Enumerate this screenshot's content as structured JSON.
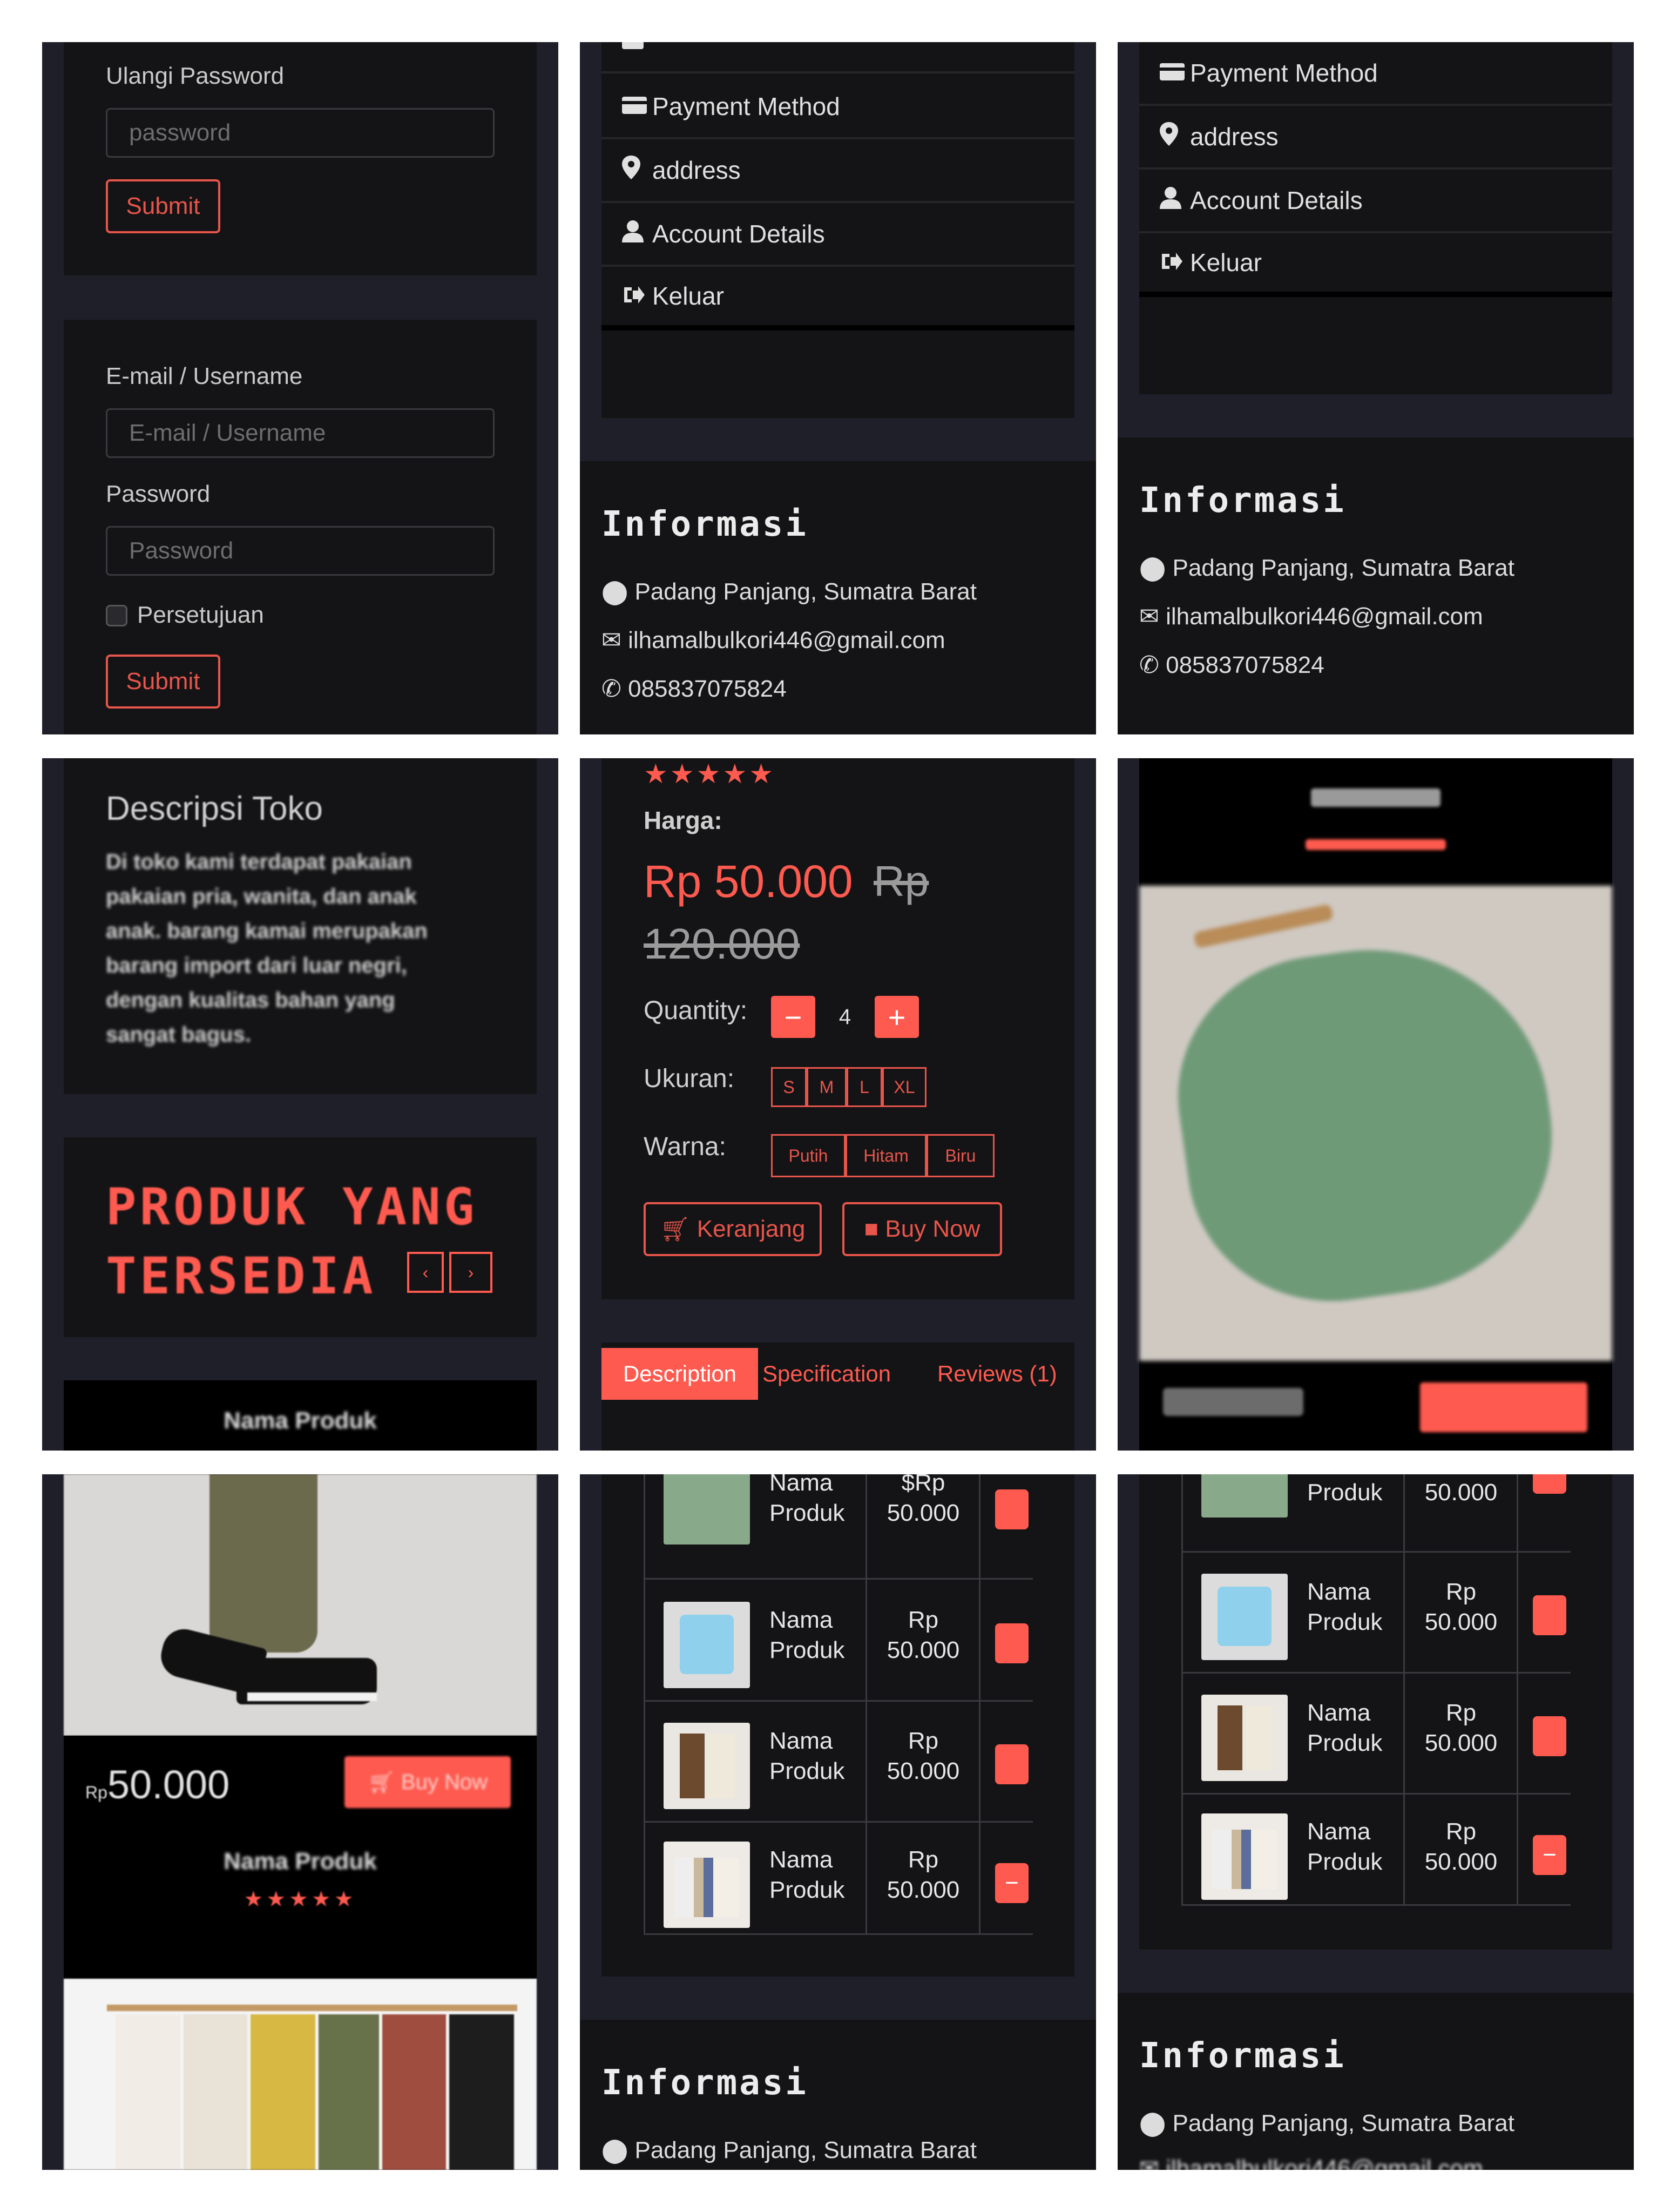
{
  "colors": {
    "accent": "#ff5a4f",
    "panel_bg": "#1f1f29",
    "card_bg": "#141416"
  },
  "p1": {
    "repeat_password_label": "Ulangi Password",
    "repeat_password_placeholder": "password",
    "submit1": "Submit",
    "email_label": "E-mail / Username",
    "email_placeholder": "E-mail / Username",
    "password_label": "Password",
    "password_placeholder": "Password",
    "consent_label": "Persetujuan",
    "submit2": "Submit"
  },
  "menu": {
    "payment": "Payment Method",
    "address": "address",
    "account": "Account Details",
    "logout": "Keluar"
  },
  "info": {
    "title": "Informasi",
    "location": "Padang Panjang, Sumatra Barat",
    "email": "ilhamalbulkori446@gmail.com",
    "phone": "085837075824"
  },
  "p4": {
    "desc_title": "Descripsi Toko",
    "desc_text": "Di toko kami terdapat pakaian pakaian pria, wanita, dan anak anak. barang kamai merupakan barang import dari luar negri, dengan kualitas bahan yang sangat bagus.",
    "products_heading_line1": "PRODUK YANG",
    "products_heading_line2": "TERSEDIA",
    "product_name": "Nama Produk"
  },
  "p5": {
    "rating": "★★★★★",
    "price_label": "Harga:",
    "price": "Rp 50.000",
    "old_price_rp": "Rp",
    "old_price": "120.000",
    "quantity_label": "Quantity:",
    "quantity": "4",
    "size_label": "Ukuran:",
    "sizes": [
      "S",
      "M",
      "L",
      "XL"
    ],
    "color_label": "Warna:",
    "colors": [
      "Putih",
      "Hitam",
      "Biru"
    ],
    "cart_btn": "Keranjang",
    "buy_btn": "Buy Now",
    "tabs": [
      "Description",
      "Specification",
      "Reviews (1)"
    ]
  },
  "p7": {
    "price": "50.000",
    "price_prefix": "Rp",
    "buy_btn": "Buy Now",
    "product_name": "Nama Produk",
    "rating": "★★★★★"
  },
  "cart8": {
    "rows": [
      {
        "name1": "Nama",
        "name2": "Produk",
        "price1": "$Rp",
        "price2": "50.000"
      },
      {
        "name1": "Nama",
        "name2": "Produk",
        "price1": "Rp",
        "price2": "50.000"
      },
      {
        "name1": "Nama",
        "name2": "Produk",
        "price1": "Rp",
        "price2": "50.000"
      },
      {
        "name1": "Nama",
        "name2": "Produk",
        "price1": "Rp",
        "price2": "50.000"
      }
    ]
  },
  "cart9": {
    "rows": [
      {
        "name2": "Produk",
        "price2": "50.000"
      },
      {
        "name1": "Nama",
        "name2": "Produk",
        "price1": "Rp",
        "price2": "50.000"
      },
      {
        "name1": "Nama",
        "name2": "Produk",
        "price1": "Rp",
        "price2": "50.000"
      },
      {
        "name1": "Nama",
        "name2": "Produk",
        "price1": "Rp",
        "price2": "50.000"
      }
    ]
  },
  "icons": [
    "credit-card-icon",
    "map-marker-icon",
    "user-icon",
    "sign-out-icon",
    "envelope-icon",
    "phone-icon",
    "cart-icon",
    "bag-icon",
    "minus-icon",
    "plus-icon",
    "chevron-left-icon",
    "chevron-right-icon",
    "trash-icon"
  ]
}
